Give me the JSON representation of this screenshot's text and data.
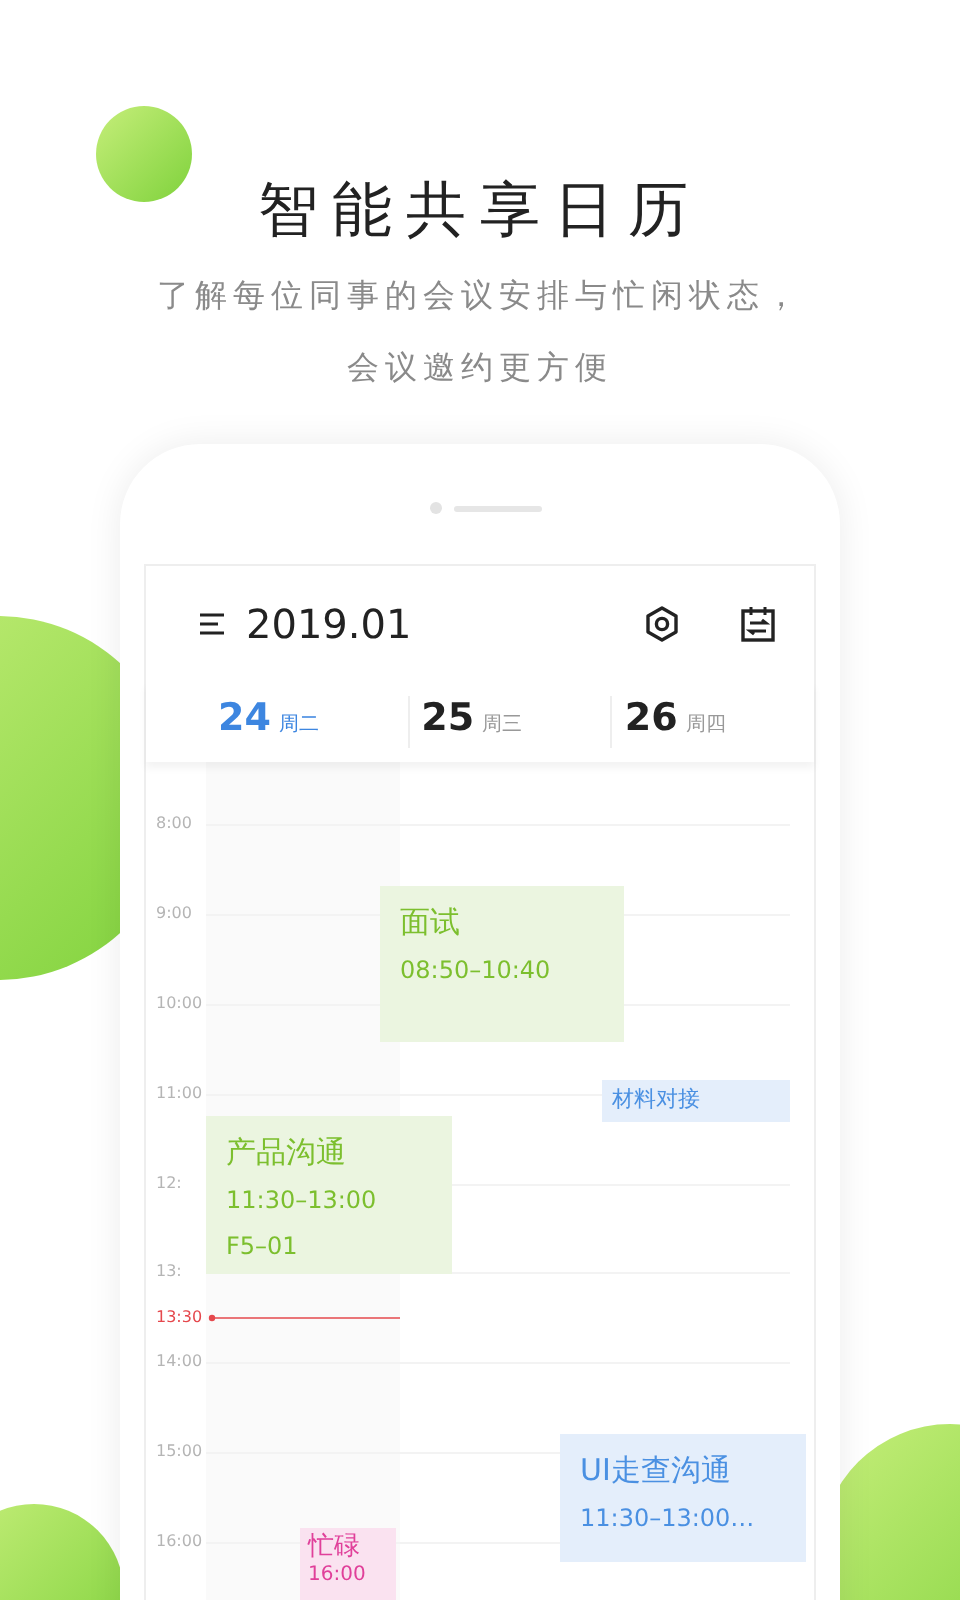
{
  "headline": "智能共享日历",
  "subtitle": [
    "了解每位同事的会议安排与忙闲状态，",
    "会议邀约更方便"
  ],
  "calendar": {
    "month": "2019.01",
    "days": [
      {
        "date": "24",
        "weekday": "周二",
        "selected": true
      },
      {
        "date": "25",
        "weekday": "周三",
        "selected": false
      },
      {
        "date": "26",
        "weekday": "周四",
        "selected": false
      }
    ],
    "times": [
      {
        "label": "8:00",
        "kind": "hour"
      },
      {
        "label": "9:00",
        "kind": "hour"
      },
      {
        "label": "10:00",
        "kind": "hour"
      },
      {
        "label": "11:00",
        "kind": "hour"
      },
      {
        "label": "12:",
        "kind": "hour"
      },
      {
        "label": "13:",
        "kind": "hour"
      },
      {
        "label": "13:30",
        "kind": "now"
      },
      {
        "label": "14:00",
        "kind": "hour"
      },
      {
        "label": "15:00",
        "kind": "hour"
      },
      {
        "label": "16:00",
        "kind": "hour"
      }
    ],
    "events": [
      {
        "title": "面试",
        "lines": [
          "08:50–10:40"
        ],
        "color": "#7cbf2e"
      },
      {
        "title": "材料对接",
        "color": "#4a90e2"
      },
      {
        "title": "产品沟通",
        "lines": [
          "11:30–13:00",
          "F5–01"
        ],
        "color": "#7cbf2e"
      },
      {
        "title": "UI走查沟通",
        "lines": [
          "11:30–13:00…"
        ],
        "color": "#4a90e2"
      },
      {
        "title": "忙碌",
        "lines": [
          "16:00"
        ],
        "color": "#e0409a"
      }
    ]
  }
}
